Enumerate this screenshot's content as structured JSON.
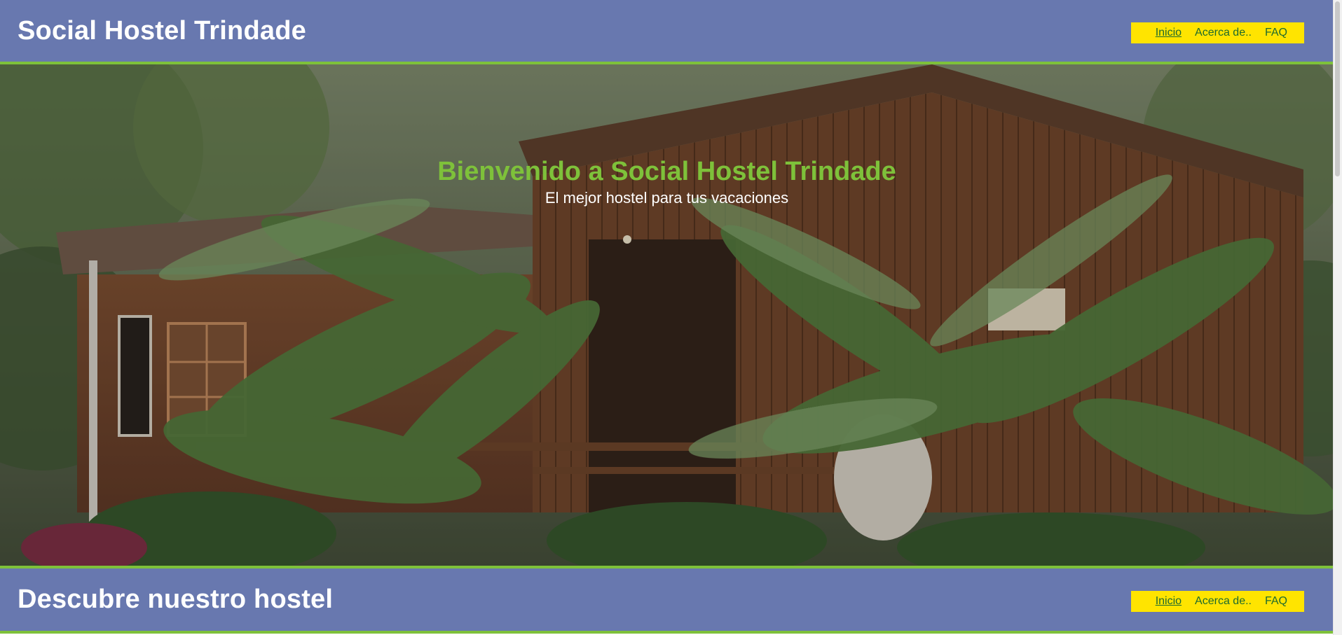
{
  "header": {
    "title": "Social Hostel Trindade",
    "nav": [
      {
        "label": "Inicio"
      },
      {
        "label": "Acerca de.."
      },
      {
        "label": "FAQ"
      }
    ]
  },
  "hero": {
    "title": "Bienvenido a Social Hostel Trindade",
    "subtitle": "El mejor hostel para tus vacaciones",
    "image": "hostel-cabin-photo"
  },
  "section": {
    "title": "Descubre nuestro hostel",
    "nav": [
      {
        "label": "Inicio"
      },
      {
        "label": "Acerca de.."
      },
      {
        "label": "FAQ"
      }
    ]
  },
  "colors": {
    "bar": "#6878af",
    "accent_green": "#7ec13a",
    "nav_yellow": "#ffe400",
    "nav_link": "#1d6a2e"
  }
}
